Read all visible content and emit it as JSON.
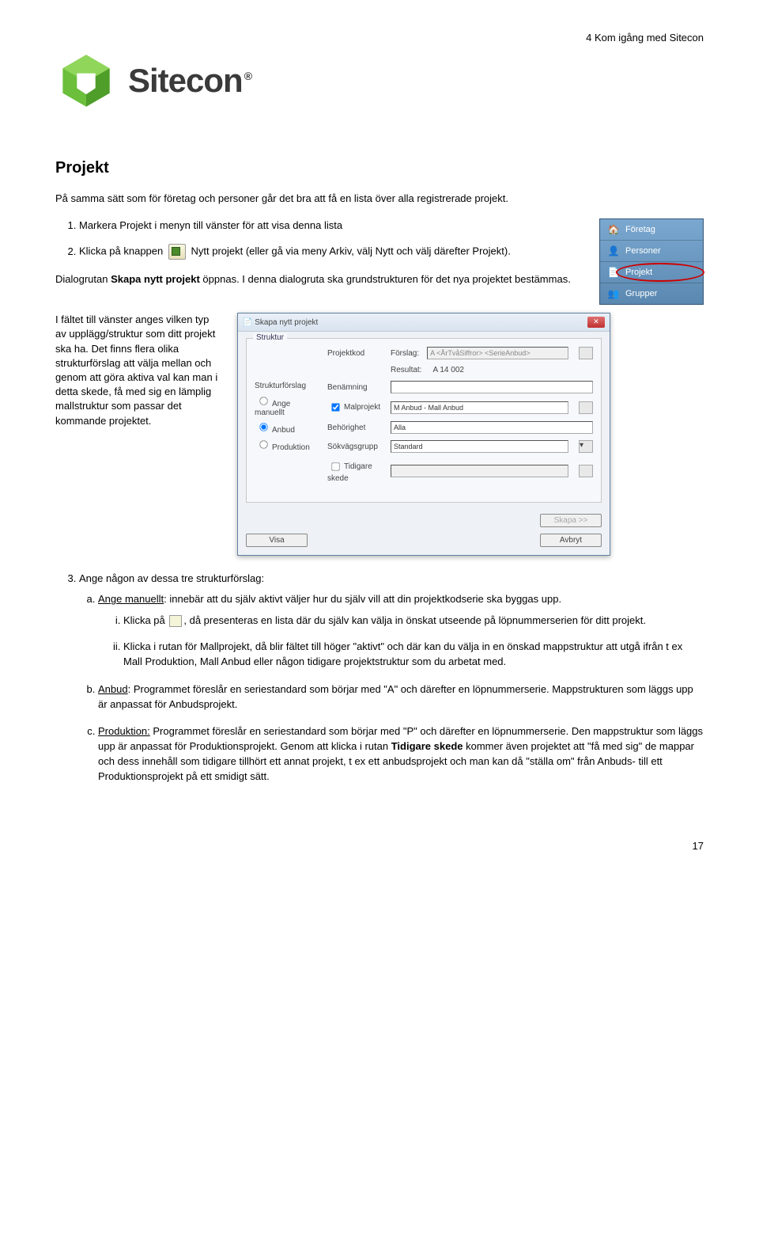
{
  "header": {
    "breadcrumb": "4 Kom igång med Sitecon"
  },
  "logo": {
    "text": "Sitecon",
    "reg": "®"
  },
  "section_title": "Projekt",
  "intro": "På samma sätt som för företag och personer går det bra att få en lista över alla registrerade projekt.",
  "steps": {
    "s1": "Markera Projekt i menyn till vänster för att visa denna lista",
    "s2a": "Klicka på knappen ",
    "s2b": " Nytt projekt (eller gå via meny Arkiv, välj Nytt och välj därefter Projekt).",
    "dialog_p1": "Dialogrutan ",
    "dialog_p1b": "Skapa nytt projekt",
    "dialog_p1c": " öppnas. I denna dialogruta ska grundstrukturen för det nya projektet bestämmas.",
    "s3": "Ange någon av dessa tre strukturförslag:"
  },
  "leftcol": "I fältet till vänster anges vilken typ av upplägg/struktur som ditt projekt ska ha. Det finns flera olika strukturförslag att välja mellan och genom att göra aktiva val kan man i detta skede, få med sig en lämplig mallstruktur som passar det kommande projektet.",
  "nav": {
    "foretag": "Företag",
    "personer": "Personer",
    "projekt": "Projekt",
    "grupper": "Grupper"
  },
  "dialog": {
    "title": "Skapa nytt projekt",
    "group": "Struktur",
    "strukturforslag": "Strukturförslag",
    "ange_manuellt": "Ange manuellt",
    "anbud": "Anbud",
    "produktion": "Produktion",
    "projektkod": "Projektkod",
    "forslag": "Förslag:",
    "forslag_val": "A <ÅrTvåSiffror> <SerieAnbud>",
    "resultat": "Resultat:",
    "resultat_val": "A 14 002",
    "benamning": "Benämning",
    "malprojekt": "Malprojekt",
    "mal_val": "M Anbud - Mall Anbud",
    "behorighet": "Behörighet",
    "beh_val": "Alla",
    "sokvag": "Sökvägsgrupp",
    "sok_val": "Standard",
    "tidigare": "Tidigare skede",
    "skapa": "Skapa >>",
    "visa": "Visa",
    "avbryt": "Avbryt"
  },
  "sub": {
    "a_lead": "Ange manuellt",
    "a_rest": ": innebär att du själv aktivt väljer hur du själv vill att din projektkodserie ska byggas upp.",
    "a_i_pre": "Klicka på ",
    "a_i_post": ", då presenteras en lista där du själv kan välja in önskat utseende på löpnummerserien för ditt projekt.",
    "a_ii": "Klicka i rutan för Mallprojekt, då blir fältet till höger \"aktivt\" och där kan du välja in en önskad mappstruktur att utgå ifrån t ex Mall Produktion, Mall Anbud eller någon tidigare projektstruktur som du arbetat med.",
    "b_lead": "Anbud",
    "b_rest": ": Programmet föreslår en seriestandard som börjar med \"A\" och därefter en löpnummerserie. Mappstrukturen som läggs upp är anpassat för Anbudsprojekt.",
    "c_lead": "Produktion:",
    "c_rest": " Programmet föreslår en seriestandard som börjar med \"P\" och därefter en löpnummerserie. Den mappstruktur som läggs upp är anpassat för Produktionsprojekt. Genom att klicka i rutan ",
    "c_bold": "Tidigare skede",
    "c_rest2": " kommer även projektet att \"få med sig\" de mappar och dess innehåll som tidigare tillhört ett annat projekt, t ex ett anbudsprojekt och man kan då \"ställa om\" från Anbuds- till ett Produktionsprojekt på ett smidigt sätt."
  },
  "pagenum": "17"
}
